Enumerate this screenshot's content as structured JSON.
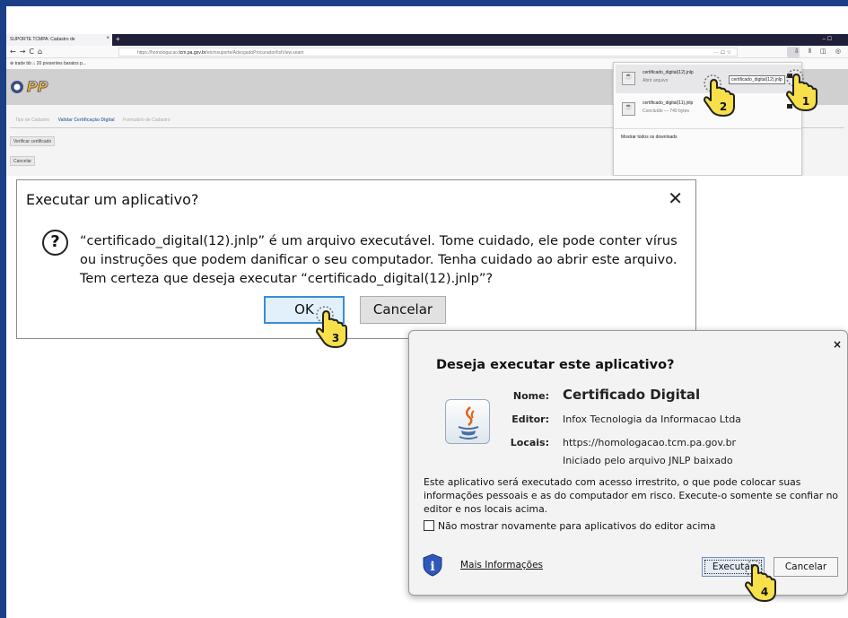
{
  "browser": {
    "tab_title": "SUPORTE TCMPA: Cadastro de",
    "tab_close": "×",
    "new_tab": "+",
    "window_controls": "–  ☐",
    "nav_icons": "←→C⌂",
    "url_prefix": "https://homologacao.",
    "url_host": "tcm.pa.gov.br",
    "url_path": "/etcmsuporte/AdvogadoProcurador/listView.seam",
    "url_right_icons": "··· ☖ ☆",
    "toolbar_icons": "⇩ ⫴ ◫ ◎",
    "bookmarks": "⊕ trade bb   ⌂ 20 presentes baratos p...",
    "steps": [
      "Tipo de Cadastro",
      "Validar Certificação Digital",
      "Formulário de Cadastro"
    ],
    "verify_button": "Verificar certificado",
    "cancel_button": "Cancelar"
  },
  "downloads": {
    "items": [
      {
        "name": "certificado_digital(12).jnlp",
        "sub": "Abrir arquivo"
      },
      {
        "name": "certificado_digital(11).jnlp",
        "sub": "Concluído — 749 bytes"
      }
    ],
    "tooltip": "certificado_digital(12).jnlp",
    "show_all": "Mostrar todos os downloads"
  },
  "win_dialog": {
    "title": "Executar um aplicativo?",
    "close": "✕",
    "message": "“certificado_digital(12).jnlp” é um arquivo executável. Tome cuidado, ele pode conter vírus ou instruções que podem danificar o seu computador. Tenha cuidado ao abrir este arquivo. Tem certeza que deseja executar “certificado_digital(12).jnlp”?",
    "ok": "OK",
    "cancel": "Cancelar"
  },
  "java_dialog": {
    "close": "×",
    "title": "Deseja executar este aplicativo?",
    "name_label": "Nome:",
    "name_value": "Certificado Digital",
    "publisher_label": "Editor:",
    "publisher_value": "Infox Tecnologia da Informacao Ltda",
    "locations_label": "Locais:",
    "location_value": "https://homologacao.tcm.pa.gov.br",
    "location_note": "Iniciado pelo arquivo JNLP baixado",
    "warning": "Este aplicativo será executado com acesso irrestrito, o que pode colocar suas informações pessoais e as do computador em risco. Execute-o somente se confiar no editor e nos locais acima.",
    "checkbox_label": "Não mostrar novamente para aplicativos do editor acima",
    "more_info": "Mais Informações",
    "execute": "Executar",
    "cancel": "Cancelar"
  },
  "markers": [
    "1",
    "2",
    "3",
    "4"
  ],
  "colors": {
    "frame": "#1b3f86",
    "hand": "#f7e04a",
    "focus": "#3b8bd8"
  }
}
